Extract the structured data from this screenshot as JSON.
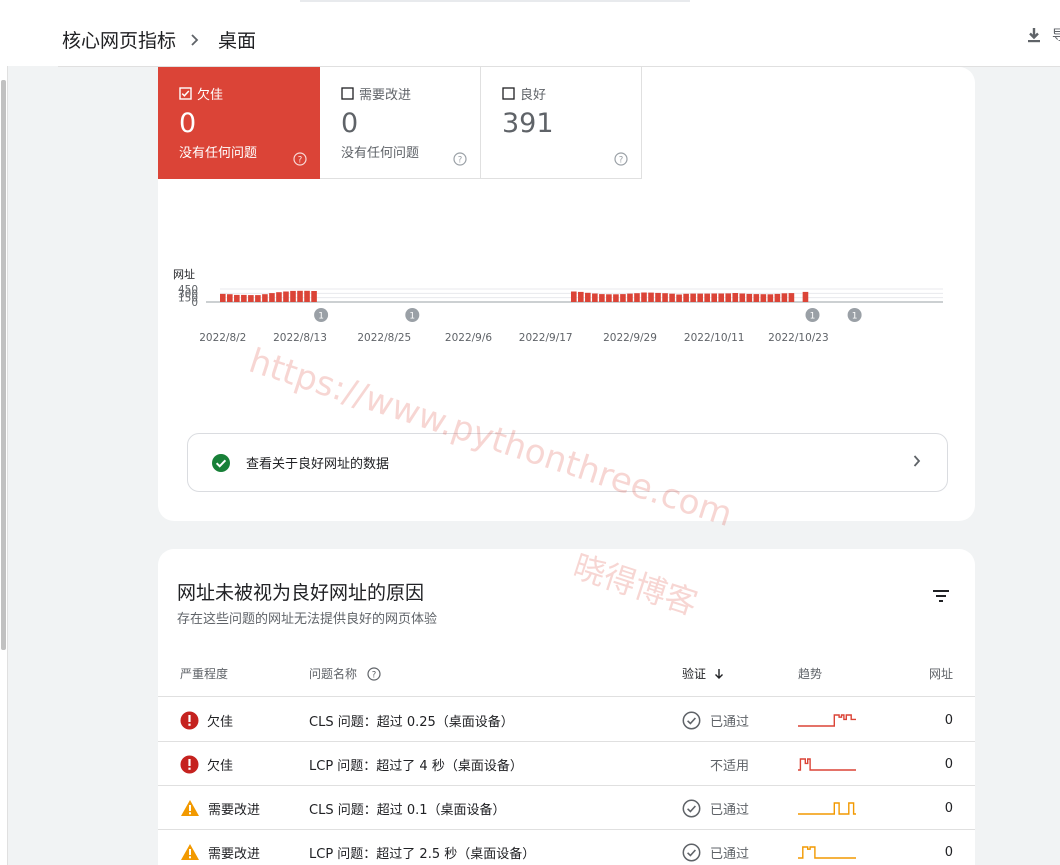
{
  "breadcrumb": {
    "parent": "核心网页指标",
    "current": "桌面"
  },
  "toolbar": {
    "export_label": "导"
  },
  "tiles": [
    {
      "label": "欠佳",
      "value": "0",
      "sub": "没有任何问题",
      "checked": true
    },
    {
      "label": "需要改进",
      "value": "0",
      "sub": "没有任何问题",
      "checked": false
    },
    {
      "label": "良好",
      "value": "391",
      "sub": "",
      "checked": false
    }
  ],
  "chart_data": {
    "type": "bar",
    "ylabel": "网址",
    "yticks": [
      0,
      150,
      300,
      450
    ],
    "ylim": [
      0,
      450
    ],
    "xticks": [
      "2022/8/2",
      "2022/8/13",
      "2022/8/25",
      "2022/9/6",
      "2022/9/17",
      "2022/9/29",
      "2022/10/11",
      "2022/10/23"
    ],
    "series": [
      {
        "color": "#db4437",
        "values": [
          282,
          270,
          245,
          245,
          238,
          238,
          270,
          308,
          340,
          365,
          385,
          388,
          388,
          382,
          null,
          null,
          null,
          null,
          null,
          null,
          null,
          null,
          null,
          null,
          null,
          null,
          null,
          null,
          null,
          null,
          null,
          null,
          null,
          null,
          null,
          null,
          null,
          null,
          null,
          null,
          null,
          null,
          null,
          null,
          null,
          null,
          null,
          null,
          null,
          null,
          362,
          350,
          318,
          295,
          275,
          268,
          265,
          275,
          290,
          305,
          328,
          325,
          315,
          305,
          288,
          258,
          285,
          292,
          292,
          292,
          295,
          295,
          298,
          310,
          295,
          282,
          272,
          270,
          265,
          282,
          302,
          308,
          null,
          350,
          null,
          null,
          null,
          null,
          null,
          null,
          null
        ]
      }
    ],
    "annotations": [
      {
        "label": "1",
        "date": "2022/8/16"
      },
      {
        "label": "1",
        "date": "2022/8/29"
      },
      {
        "label": "1",
        "date": "2022/10/25"
      },
      {
        "label": "1",
        "date": "2022/10/31"
      }
    ]
  },
  "good_link": {
    "label": "查看关于良好网址的数据"
  },
  "issues": {
    "title": "网址未被视为良好网址的原因",
    "subtitle": "存在这些问题的网址无法提供良好的网页体验",
    "columns": {
      "severity": "严重程度",
      "name": "问题名称",
      "validation": "验证",
      "trend": "趋势",
      "urls": "网址"
    },
    "rows": [
      {
        "severity": "欠佳",
        "severity_type": "poor",
        "name": "CLS 问题：超过 0.25（桌面设备）",
        "validation": "已通过",
        "validation_icon": true,
        "trend_color": "#db4437",
        "trend": [
          0,
          0,
          0,
          0,
          0,
          0,
          0,
          0,
          0,
          0,
          0,
          0,
          0,
          0,
          0,
          1,
          1,
          0.8,
          1,
          0.6,
          1,
          1,
          0.6,
          0.6
        ],
        "urls": "0"
      },
      {
        "severity": "欠佳",
        "severity_type": "poor",
        "name": "LCP 问题：超过了 4 秒（桌面设备）",
        "validation": "不适用",
        "validation_icon": false,
        "trend_color": "#db4437",
        "trend": [
          0,
          1,
          1,
          0.6,
          1,
          0,
          0,
          0,
          0,
          0,
          0,
          0,
          0,
          0,
          0,
          0,
          0,
          0,
          0,
          0,
          0,
          0,
          0,
          0
        ],
        "urls": "0"
      },
      {
        "severity": "需要改进",
        "severity_type": "ni",
        "name": "CLS 问题：超过 0.1（桌面设备）",
        "validation": "已通过",
        "validation_icon": true,
        "trend_color": "#f29900",
        "trend": [
          0,
          0,
          0,
          0,
          0,
          0,
          0,
          0,
          0,
          0,
          0,
          0,
          0,
          0,
          0,
          1,
          1,
          0,
          0,
          0,
          0,
          1,
          1,
          0
        ],
        "urls": "0"
      },
      {
        "severity": "需要改进",
        "severity_type": "ni",
        "name": "LCP 问题：超过了 2.5 秒（桌面设备）",
        "validation": "已通过",
        "validation_icon": true,
        "trend_color": "#f29900",
        "trend": [
          0,
          0,
          1,
          1,
          0.8,
          1,
          1,
          0,
          0,
          0,
          0,
          0,
          0,
          0,
          0,
          0,
          0,
          0,
          0,
          0,
          0,
          0,
          0,
          0
        ],
        "urls": "0"
      }
    ]
  },
  "watermark": {
    "url": "https://www.pythonthree.com",
    "name": "晓得博客"
  }
}
